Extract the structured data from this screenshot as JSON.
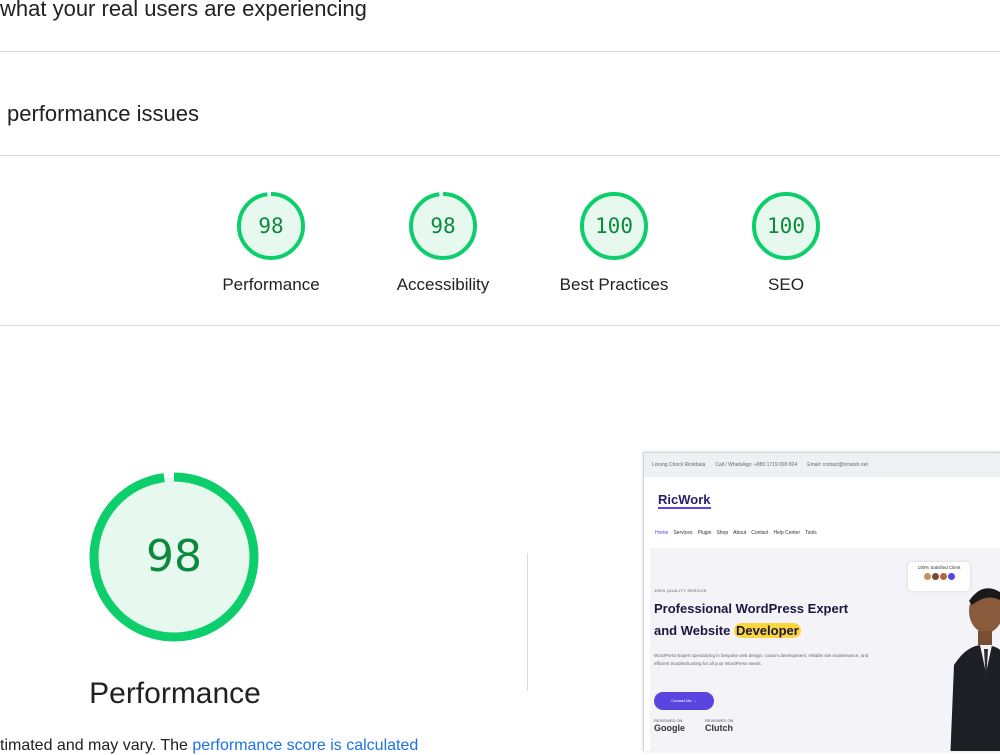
{
  "header": {
    "crux_title": "what your real users are experiencing",
    "diagnose_title": "performance issues"
  },
  "categories": [
    {
      "label": "Performance",
      "score": "98",
      "value": 98
    },
    {
      "label": "Accessibility",
      "score": "98",
      "value": 98
    },
    {
      "label": "Best Practices",
      "score": "100",
      "value": 100
    },
    {
      "label": "SEO",
      "score": "100",
      "value": 100
    }
  ],
  "performance": {
    "score": "98",
    "value": 98,
    "label": "Performance",
    "footnote_prefix": "timated and may vary. The ",
    "footnote_link": "performance score is calculated"
  },
  "colors": {
    "pass": "#0cce6b",
    "pass_fill": "#e7f8ee",
    "pass_text": "#0b8a3e",
    "link": "#1a73e8"
  },
  "thumbnail": {
    "topbar": [
      "Lorung Chock Rimkbala",
      "Call / WhatsApp: +880 1719 090 824",
      "Email: contact@ricwork.net"
    ],
    "logo": "RicWork",
    "nav": [
      "Home",
      "Services",
      "Plugin",
      "Shop",
      "About",
      "Contact",
      "Help Center",
      "Tools"
    ],
    "eyebrow": "100% QUALITY SERVICE",
    "headline_line1": "Professional WordPress Expert",
    "headline_line2_a": "and Website ",
    "headline_line2_b": "Developer",
    "description": "WordPress Expert specializing in bespoke web design, custom development, reliable site maintenance, and efficient troubleshooting for all your WordPress needs.",
    "cta": "Contact Me",
    "badge1_small": "REVIEWED ON",
    "badge1": "Google",
    "badge2_small": "REVIEWED ON",
    "badge2": "Clutch",
    "satisfied": "100% Satisfied Client"
  }
}
